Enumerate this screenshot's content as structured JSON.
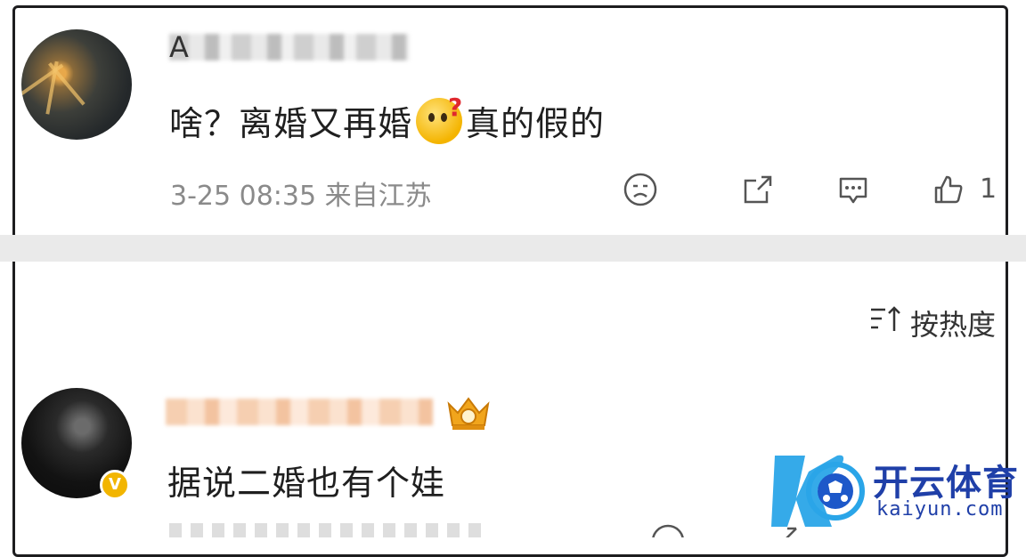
{
  "comments": [
    {
      "username_prefix": "A",
      "text_before": "啥？离婚又再婚",
      "text_after": "真的假的",
      "emoji_name": "confused-face-question",
      "meta": "3-25 08:35 来自江苏",
      "like_count": "1"
    },
    {
      "text": "据说二婚也有个娃",
      "badge": "V"
    }
  ],
  "sort_label": "按热度",
  "watermark": {
    "title": "开云体育",
    "url": "kaiyun.com"
  },
  "icons": [
    "sad-face-icon",
    "share-icon",
    "comment-icon",
    "like-icon",
    "sort-icon",
    "crown-badge-icon",
    "vip-badge-icon"
  ]
}
